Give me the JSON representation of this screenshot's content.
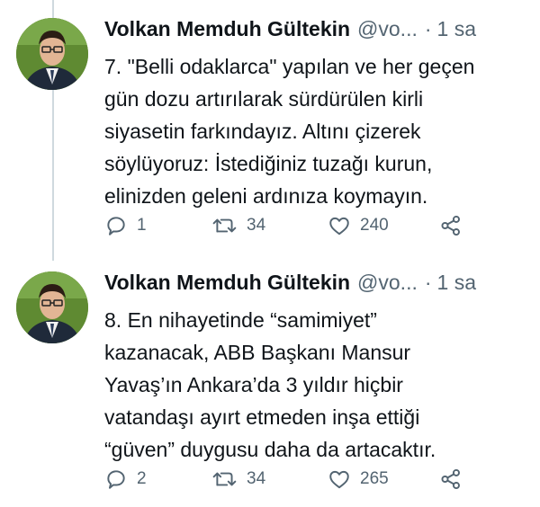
{
  "tweets": [
    {
      "author_name": "Volkan Memduh Gültekin",
      "handle": "@vo...",
      "separator": "·",
      "time": "1 sa",
      "lines": [
        "7. \"Belli odaklarca\" yapılan ve her geçen",
        "gün dozu artırılarak sürdürülen kirli",
        "siyasetin farkındayız. Altını çizerek",
        "söylüyoruz: İstediğiniz tuzağı kurun,",
        "elinizden geleni ardınıza koymayın."
      ],
      "reply_count": "1",
      "retweet_count": "34",
      "like_count": "240"
    },
    {
      "author_name": "Volkan Memduh Gültekin",
      "handle": "@vo...",
      "separator": "·",
      "time": "1 sa",
      "lines": [
        "8. En nihayetinde “samimiyet”",
        "kazanacak, ABB Başkanı Mansur",
        "Yavaş’ın Ankara’da 3 yıldır hiçbir",
        "vatandaşı ayırt etmeden inşa ettiği",
        "“güven” duygusu daha da artacaktır."
      ],
      "reply_count": "2",
      "retweet_count": "34",
      "like_count": "265"
    }
  ],
  "icons": {
    "reply": "reply-icon",
    "retweet": "retweet-icon",
    "like": "heart-icon",
    "share": "share-icon"
  },
  "colors": {
    "text": "#0f1419",
    "secondary": "#536471",
    "thread_line": "#cfd9de"
  }
}
